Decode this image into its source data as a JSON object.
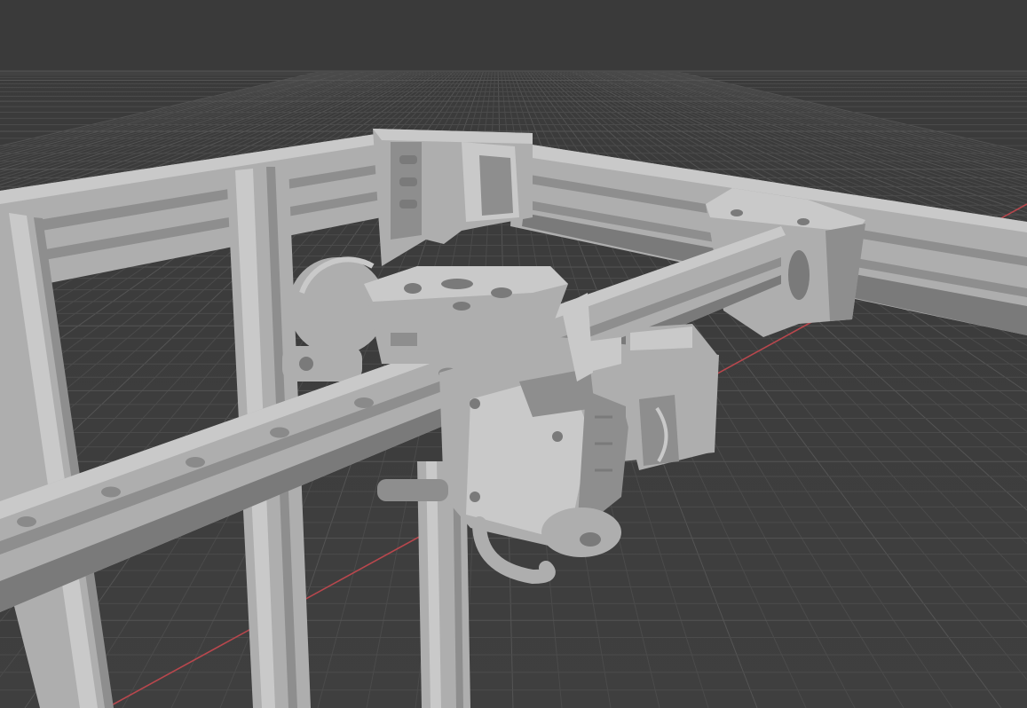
{
  "viewport": {
    "background": "#3d3d3d",
    "grid_color": "#4b4b4b",
    "grid_color_major": "#545454",
    "x_axis_color": "#b8474d",
    "model_base_color": "#aeaeae",
    "model_light_color": "#c9c9c9",
    "model_shadow_color": "#8e8e8e",
    "overlay_text": {
      "title": "",
      "mode": ""
    }
  },
  "scene": {
    "objects": [
      {
        "name": "aluminum-extrusion-frame-left"
      },
      {
        "name": "aluminum-extrusion-frame-back"
      },
      {
        "name": "linear-rail-x"
      },
      {
        "name": "y-carriage-left"
      },
      {
        "name": "y-carriage-right"
      },
      {
        "name": "toolhead"
      },
      {
        "name": "extruder-motor"
      },
      {
        "name": "vertical-extrusion"
      },
      {
        "name": "hotend"
      }
    ]
  }
}
